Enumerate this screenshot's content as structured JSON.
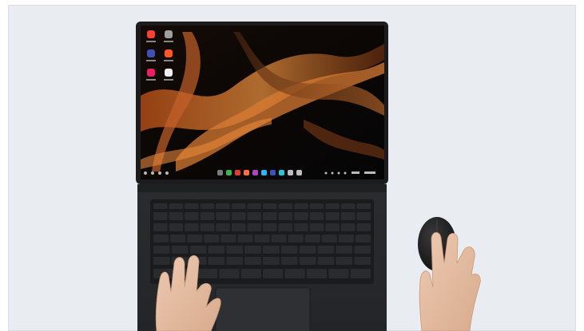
{
  "image": {
    "alt": "",
    "frame_color": "#e9ecf0",
    "device_color": "#2a2b2e",
    "wallpaper_colors": [
      "#1a0d05",
      "#c2571c",
      "#e8893b",
      "#050506"
    ],
    "dock_icon_colors": [
      "#7b7b7b",
      "#39b54a",
      "#e53935",
      "#ff7043",
      "#ab47bc",
      "#29b6f6",
      "#3f51b5",
      "#26c6da",
      "#bdbdbd"
    ],
    "desktop_icon_colors": [
      "#f44336",
      "#9e9e9e",
      "#3f51b5",
      "#ff5722",
      "#e91e63",
      "#eeeeee"
    ],
    "mouse_color": "#1b1b1c",
    "skin_color": "#e6c1a6"
  }
}
